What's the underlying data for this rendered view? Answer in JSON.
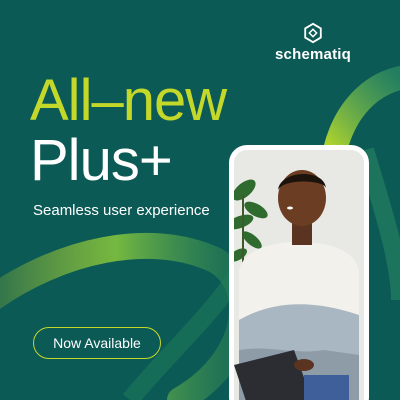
{
  "brand": {
    "name": "schematiq",
    "icon": "hexagon-logo-icon"
  },
  "headline": {
    "line1": "All–new",
    "line2": "Plus+"
  },
  "subtitle": "Seamless user experience",
  "cta": {
    "label": "Now Available"
  },
  "photo": {
    "subject": "man with laptop"
  },
  "colors": {
    "background": "#0c5a55",
    "accent": "#c4d82a",
    "text": "#ffffff"
  }
}
